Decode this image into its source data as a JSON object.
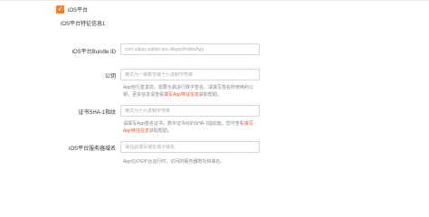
{
  "ios": {
    "checkbox_checked": true,
    "checkbox_mark": "✓",
    "checkbox_label": "iOS平台",
    "section_title": "iOS平台特征信息1",
    "accent_color": "#f5812b"
  },
  "fields": {
    "bundle_id": {
      "label": "iOS平台Bundle ID",
      "value": "com.alipay.walletr.anc.AlipayMobileApp"
    },
    "public_key": {
      "label": "公钥",
      "placeholder": "格式为一串数字或十六进制字符串",
      "help_pre": "App自行签发前，需要为其进行数字签名，请填写签名所使用的公钥，更多信息请查看",
      "help_link": "填写App特征信息",
      "help_post": "获取帮助。"
    },
    "cert_sha1": {
      "label": "证书SHA-1指纹",
      "placeholder": "格式为十六进制字符串",
      "help_pre": "请填写App签名证书，数字证书对的SHA-1指纹值。您可查看",
      "help_link": "填写App特征信息",
      "help_post": "获取帮助。"
    },
    "server_domain": {
      "label": "iOS平台服务器域名",
      "placeholder": "请在此填写域名或子域名",
      "help": "App在iOS平台运行时，访问的服务器地址和域名。"
    }
  }
}
